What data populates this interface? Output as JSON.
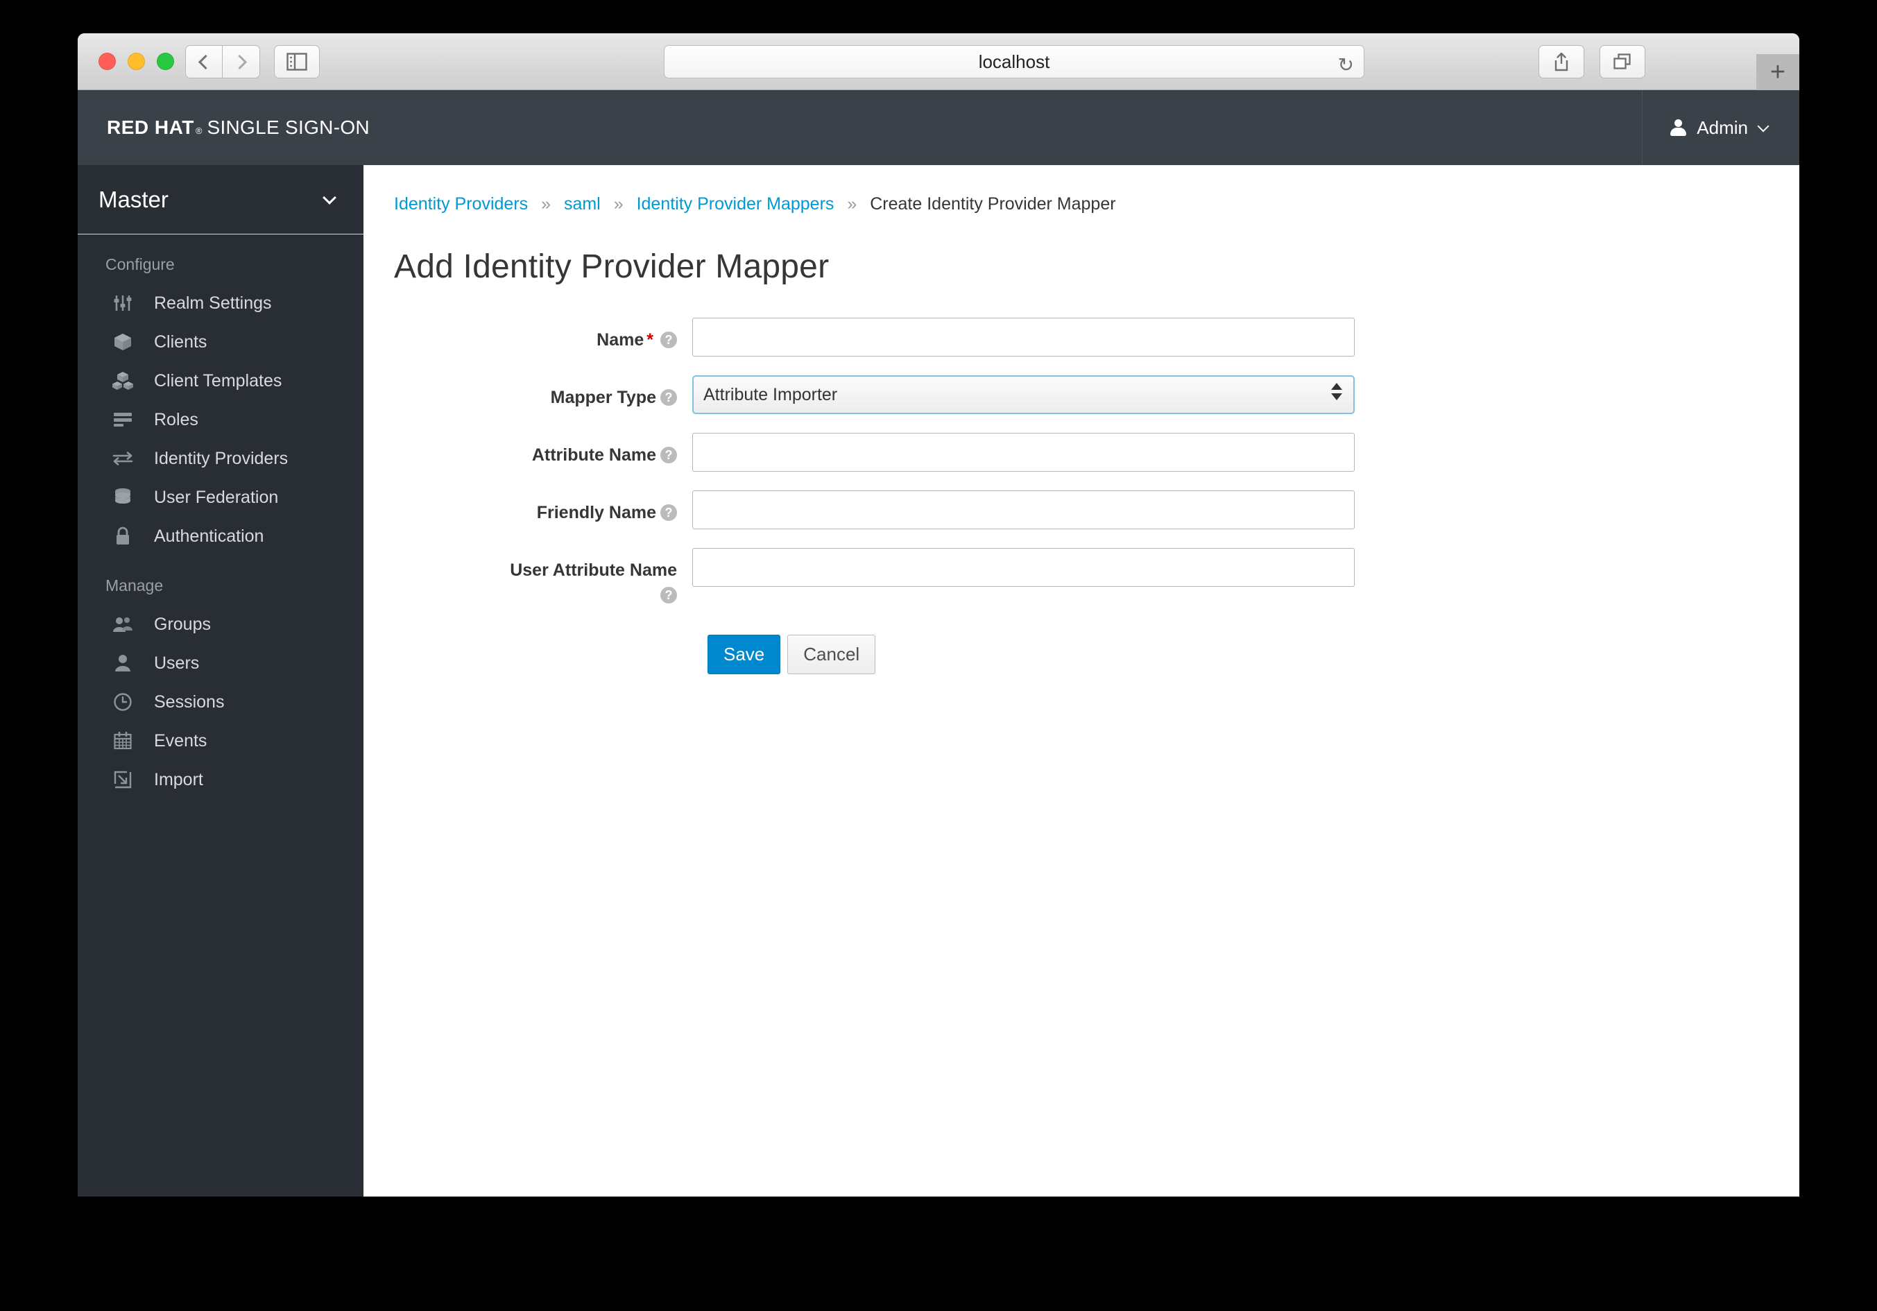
{
  "browser": {
    "url": "localhost",
    "reload_icon": "reload-icon",
    "back_icon": "chevron-left-icon",
    "forward_icon": "chevron-right-icon",
    "sidebar_icon": "sidebar-toggle-icon",
    "share_icon": "share-icon",
    "tabs_icon": "show-tabs-icon",
    "newtab_label": "+"
  },
  "masthead": {
    "brand_bold": "RED HAT",
    "brand_reg": "®",
    "brand_rest": "SINGLE SIGN-ON",
    "user_label": "Admin",
    "user_icon": "user-icon",
    "caret_icon": "chevron-down-icon"
  },
  "sidebar": {
    "realm": "Master",
    "realm_caret": "chevron-down-icon",
    "sections": [
      {
        "title": "Configure",
        "items": [
          {
            "label": "Realm Settings",
            "icon": "sliders-icon"
          },
          {
            "label": "Clients",
            "icon": "cube-icon"
          },
          {
            "label": "Client Templates",
            "icon": "cubes-icon"
          },
          {
            "label": "Roles",
            "icon": "list-icon"
          },
          {
            "label": "Identity Providers",
            "icon": "exchange-arrows-icon"
          },
          {
            "label": "User Federation",
            "icon": "database-icon"
          },
          {
            "label": "Authentication",
            "icon": "lock-icon"
          }
        ]
      },
      {
        "title": "Manage",
        "items": [
          {
            "label": "Groups",
            "icon": "group-icon"
          },
          {
            "label": "Users",
            "icon": "user-icon"
          },
          {
            "label": "Sessions",
            "icon": "clock-icon"
          },
          {
            "label": "Events",
            "icon": "calendar-icon"
          },
          {
            "label": "Import",
            "icon": "import-arrow-icon"
          }
        ]
      }
    ]
  },
  "main": {
    "breadcrumb": [
      {
        "label": "Identity Providers",
        "link": true
      },
      {
        "label": "saml",
        "link": true
      },
      {
        "label": "Identity Provider Mappers",
        "link": true
      },
      {
        "label": "Create Identity Provider Mapper",
        "link": false
      }
    ],
    "separator": "»",
    "page_title": "Add Identity Provider Mapper",
    "fields": [
      {
        "label": "Name",
        "required": true,
        "help": "?",
        "type": "text",
        "value": "",
        "placeholder": ""
      },
      {
        "label": "Mapper Type",
        "required": false,
        "help": "?",
        "type": "select",
        "value": "Attribute Importer"
      },
      {
        "label": "Attribute Name",
        "required": false,
        "help": "?",
        "type": "text",
        "value": "",
        "placeholder": ""
      },
      {
        "label": "Friendly Name",
        "required": false,
        "help": "?",
        "type": "text",
        "value": "",
        "placeholder": ""
      },
      {
        "label": "User Attribute Name",
        "required": false,
        "help": "?",
        "type": "text",
        "value": "",
        "placeholder": ""
      }
    ],
    "save_label": "Save",
    "cancel_label": "Cancel"
  },
  "colors": {
    "accent": "#0088ce",
    "link": "#0099d3",
    "sidebar_bg": "#292e34",
    "masthead_bg": "#3a4148",
    "required": "#cc0000"
  }
}
